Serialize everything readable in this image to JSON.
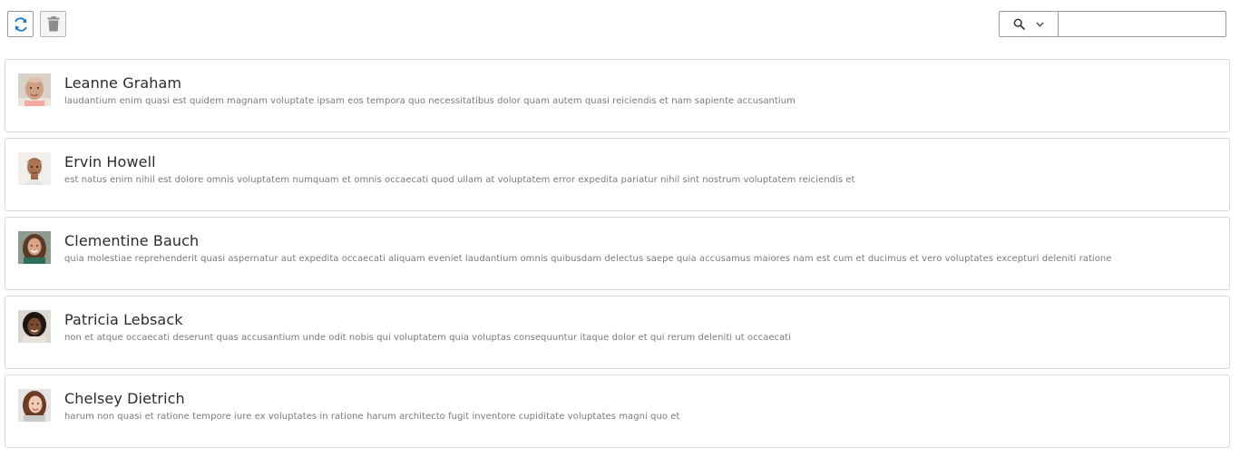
{
  "toolbar": {
    "refresh_icon": "refresh-icon",
    "delete_icon": "trash-icon"
  },
  "search": {
    "icon": "search-icon",
    "scope_icon": "chevron-down-icon",
    "value": "",
    "placeholder": ""
  },
  "colors": {
    "accent": "#1e73be",
    "border": "#d9d9d9",
    "text_primary": "#2b2b2b",
    "text_secondary": "#7a7a7a"
  },
  "users": [
    {
      "name": "Leanne Graham",
      "description": "laudantium enim quasi est quidem magnam voluptate ipsam eos tempora quo necessitatibus dolor quam autem quasi reiciendis et nam sapiente accusantium"
    },
    {
      "name": "Ervin Howell",
      "description": "est natus enim nihil est dolore omnis voluptatem numquam et omnis occaecati quod ullam at voluptatem error expedita pariatur nihil sint nostrum voluptatem reiciendis et"
    },
    {
      "name": "Clementine Bauch",
      "description": "quia molestiae reprehenderit quasi aspernatur aut expedita occaecati aliquam eveniet laudantium omnis quibusdam delectus saepe quia accusamus maiores nam est cum et ducimus et vero voluptates excepturi deleniti ratione"
    },
    {
      "name": "Patricia Lebsack",
      "description": "non et atque occaecati deserunt quas accusantium unde odit nobis qui voluptatem quia voluptas consequuntur itaque dolor et qui rerum deleniti ut occaecati"
    },
    {
      "name": "Chelsey Dietrich",
      "description": "harum non quasi et ratione tempore iure ex voluptates in ratione harum architecto fugit inventore cupiditate voluptates magni quo et"
    }
  ]
}
